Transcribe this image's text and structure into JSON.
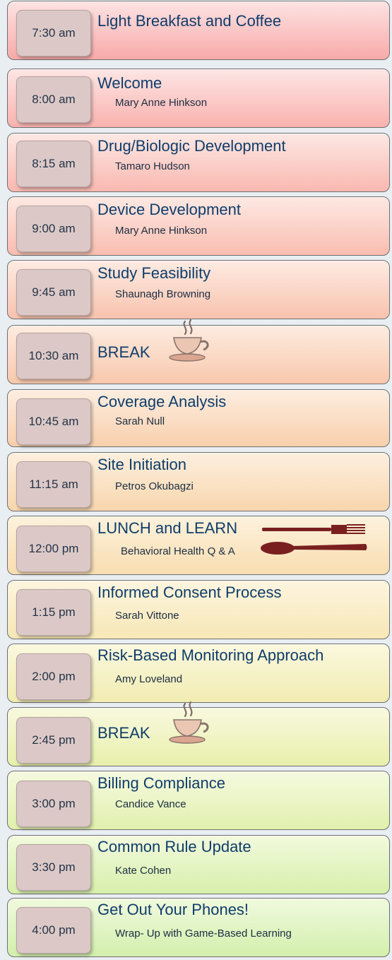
{
  "schedule": [
    {
      "time": "7:30 am",
      "title": "Light Breakfast and Coffee",
      "speaker": "",
      "bg_top": "#fde3e3",
      "bg_bottom": "#f8aaa9"
    },
    {
      "time": "8:00 am",
      "title": "Welcome",
      "speaker": "Mary Anne Hinkson",
      "bg_top": "#fde6e4",
      "bg_bottom": "#f9b2af"
    },
    {
      "time": "8:15 am",
      "title": "Drug/Biologic Development",
      "speaker": "Tamaro Hudson",
      "bg_top": "#fde8e4",
      "bg_bottom": "#f9b8b0"
    },
    {
      "time": "9:00 am",
      "title": "Device Development",
      "speaker": "Mary Anne Hinkson",
      "bg_top": "#fde9e3",
      "bg_bottom": "#f9bdb0"
    },
    {
      "time": "9:45 am",
      "title": "Study Feasibility",
      "speaker": "Shaunagh Browning",
      "bg_top": "#fdebe2",
      "bg_bottom": "#f8c3ae"
    },
    {
      "time": "10:30 am",
      "title": "BREAK",
      "speaker": "",
      "icon": "coffee-cup",
      "bg_top": "#fdece1",
      "bg_bottom": "#f8c8ac"
    },
    {
      "time": "10:45 am",
      "title": "Coverage Analysis",
      "speaker": "Sarah Null",
      "bg_top": "#fdeee0",
      "bg_bottom": "#f8cfac"
    },
    {
      "time": "11:15 am",
      "title": "Site Initiation",
      "speaker": "Petros Okubagzi",
      "bg_top": "#fdf0df",
      "bg_bottom": "#f8d6ad"
    },
    {
      "time": "12:00 pm",
      "title": "LUNCH and LEARN",
      "speaker": "Behavioral Health Q & A",
      "icon": "fork-spoon",
      "bg_top": "#fdf2dd",
      "bg_bottom": "#f8ddb0"
    },
    {
      "time": "1:15 pm",
      "title": "Informed Consent Process",
      "speaker": "Sarah Vittone",
      "bg_top": "#fdf5df",
      "bg_bottom": "#f7e7b6"
    },
    {
      "time": "2:00 pm",
      "title": "Risk-Based Monitoring Approach",
      "speaker": "Amy Loveland",
      "bg_top": "#fbf8df",
      "bg_bottom": "#f1ecb1"
    },
    {
      "time": "2:45 pm",
      "title": "BREAK",
      "speaker": "",
      "icon": "coffee-cup",
      "bg_top": "#f8f9de",
      "bg_bottom": "#e8f0ac"
    },
    {
      "time": "3:00 pm",
      "title": "Billing Compliance",
      "speaker": "Candice Vance",
      "bg_top": "#f5fadf",
      "bg_bottom": "#e1f0ad"
    },
    {
      "time": "3:30 pm",
      "title": "Common Rule Update",
      "speaker": "Kate Cohen",
      "bg_top": "#f2fadd",
      "bg_bottom": "#d8efab"
    },
    {
      "time": "4:00 pm",
      "title": "Get Out Your Phones!",
      "speaker": "Wrap- Up with Game-Based Learning",
      "bg_top": "#f0fade",
      "bg_bottom": "#d3efac"
    }
  ]
}
